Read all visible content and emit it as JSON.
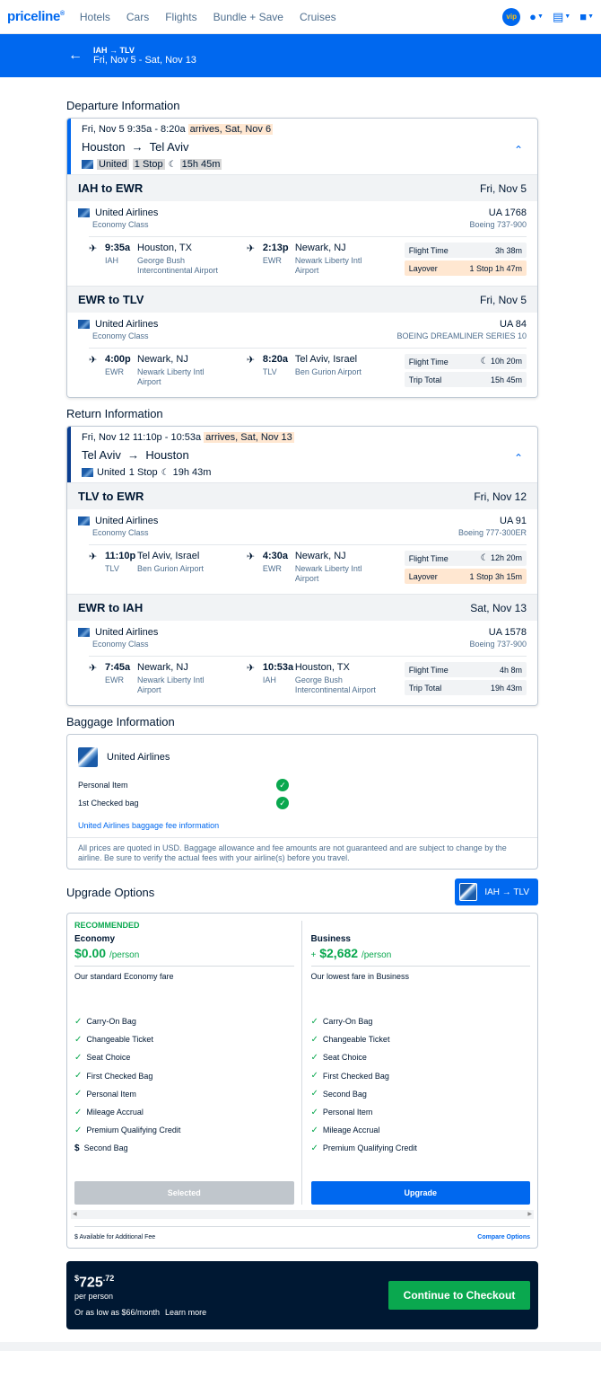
{
  "nav": {
    "logo": "priceline",
    "links": [
      "Hotels",
      "Cars",
      "Flights",
      "Bundle + Save",
      "Cruises"
    ],
    "vip": "vip"
  },
  "header": {
    "route": "IAH → TLV",
    "dates": "Fri, Nov 5 - Sat, Nov 13"
  },
  "departure": {
    "title": "Departure Information",
    "summary": {
      "dates": "Fri, Nov 5   9:35a - 8:20a",
      "arrives": "arrives, Sat, Nov 6",
      "from": "Houston",
      "to": "Tel Aviv",
      "airline": "United",
      "stops": "1 Stop",
      "duration": "15h 45m"
    },
    "legs": [
      {
        "route": "IAH to EWR",
        "date": "Fri, Nov 5",
        "airline": "United Airlines",
        "flight": "UA 1768",
        "cabin": "Economy Class",
        "aircraft": "Boeing 737-900",
        "dep_time": "9:35a",
        "dep_code": "IAH",
        "dep_city": "Houston, TX",
        "dep_airport": "George Bush Intercontinental Airport",
        "arr_time": "2:13p",
        "arr_code": "EWR",
        "arr_city": "Newark, NJ",
        "arr_airport": "Newark Liberty Intl Airport",
        "info1_label": "Flight Time",
        "info1_value": "3h 38m",
        "info2_label": "Layover",
        "info2_value": "1 Stop 1h 47m"
      },
      {
        "route": "EWR to TLV",
        "date": "Fri, Nov 5",
        "airline": "United Airlines",
        "flight": "UA 84",
        "cabin": "Economy Class",
        "aircraft": "BOEING DREAMLINER SERIES 10",
        "dep_time": "4:00p",
        "dep_code": "EWR",
        "dep_city": "Newark, NJ",
        "dep_airport": "Newark Liberty Intl Airport",
        "arr_time": "8:20a",
        "arr_code": "TLV",
        "arr_city": "Tel Aviv, Israel",
        "arr_airport": "Ben Gurion Airport",
        "info1_label": "Flight Time",
        "info1_value": "10h 20m",
        "info2_label": "Trip Total",
        "info2_value": "15h 45m"
      }
    ]
  },
  "return": {
    "title": "Return Information",
    "summary": {
      "dates": "Fri, Nov 12   11:10p - 10:53a",
      "arrives": "arrives, Sat, Nov 13",
      "from": "Tel Aviv",
      "to": "Houston",
      "airline": "United",
      "stops": "1 Stop",
      "duration": "19h 43m"
    },
    "legs": [
      {
        "route": "TLV to EWR",
        "date": "Fri, Nov 12",
        "airline": "United Airlines",
        "flight": "UA 91",
        "cabin": "Economy Class",
        "aircraft": "Boeing 777-300ER",
        "dep_time": "11:10p",
        "dep_code": "TLV",
        "dep_city": "Tel Aviv, Israel",
        "dep_airport": "Ben Gurion Airport",
        "arr_time": "4:30a",
        "arr_code": "EWR",
        "arr_city": "Newark, NJ",
        "arr_airport": "Newark Liberty Intl Airport",
        "info1_label": "Flight Time",
        "info1_value": "12h 20m",
        "info2_label": "Layover",
        "info2_value": "1 Stop 3h 15m"
      },
      {
        "route": "EWR to IAH",
        "date": "Sat, Nov 13",
        "airline": "United Airlines",
        "flight": "UA 1578",
        "cabin": "Economy Class",
        "aircraft": "Boeing 737-900",
        "dep_time": "7:45a",
        "dep_code": "EWR",
        "dep_city": "Newark, NJ",
        "dep_airport": "Newark Liberty Intl Airport",
        "arr_time": "10:53a",
        "arr_code": "IAH",
        "arr_city": "Houston, TX",
        "arr_airport": "George Bush Intercontinental Airport",
        "info1_label": "Flight Time",
        "info1_value": "4h 8m",
        "info2_label": "Trip Total",
        "info2_value": "19h 43m"
      }
    ]
  },
  "baggage": {
    "title": "Baggage Information",
    "airline": "United Airlines",
    "items": [
      "Personal Item",
      "1st Checked bag"
    ],
    "link": "United Airlines baggage fee information",
    "note": "All prices are quoted in USD. Baggage allowance and fee amounts are not guaranteed and are subject to change by the airline. Be sure to verify the actual fees with your airline(s) before you travel."
  },
  "upgrade": {
    "title": "Upgrade Options",
    "route": "IAH → TLV",
    "economy": {
      "badge": "RECOMMENDED",
      "name": "Economy",
      "price": "$0.00",
      "per": "/person",
      "desc": "Our standard Economy fare",
      "features": [
        "Carry-On Bag",
        "Changeable Ticket",
        "Seat Choice",
        "First Checked Bag",
        "Personal Item",
        "Mileage Accrual",
        "Premium Qualifying Credit"
      ],
      "paid_feature": "Second Bag",
      "button": "Selected"
    },
    "business": {
      "name": "Business",
      "plus": "+",
      "price": "$2,682",
      "per": "/person",
      "desc": "Our lowest fare in Business",
      "features": [
        "Carry-On Bag",
        "Changeable Ticket",
        "Seat Choice",
        "First Checked Bag",
        "Second Bag",
        "Personal Item",
        "Mileage Accrual",
        "Premium Qualifying Credit"
      ],
      "button": "Upgrade"
    },
    "footnote": "Available for Additional Fee",
    "compare": "Compare Options"
  },
  "checkout": {
    "currency": "$",
    "dollars": "725",
    "cents": ".72",
    "per": "per person",
    "aslow": "Or as low as $66/month",
    "learn": "Learn more",
    "button": "Continue to Checkout"
  }
}
